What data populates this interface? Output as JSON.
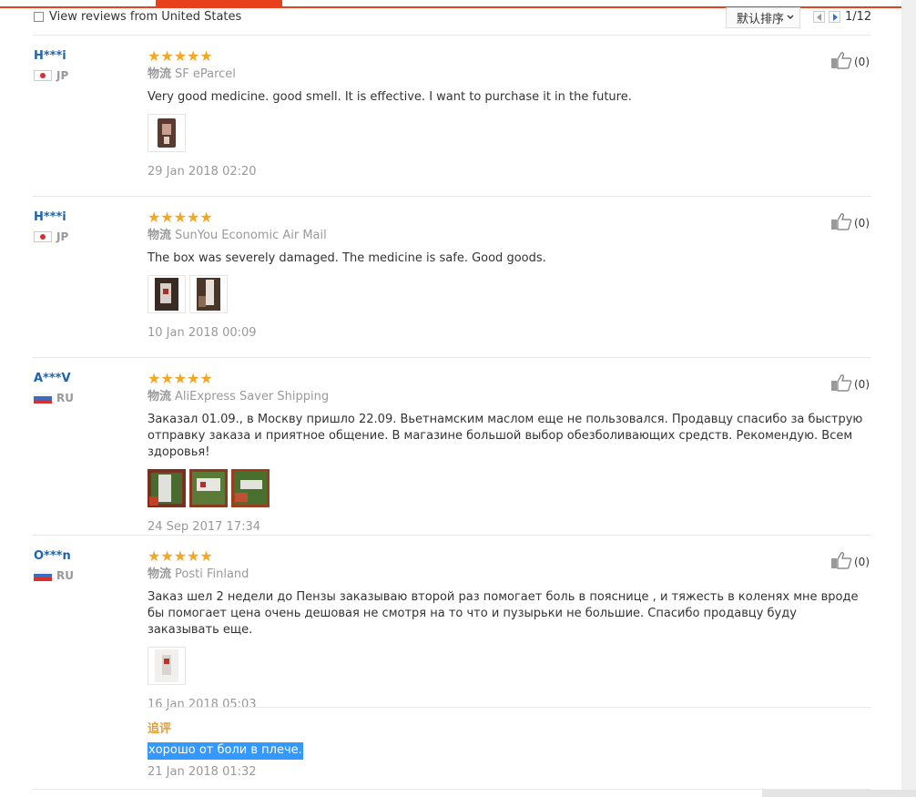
{
  "toolbar": {
    "filter_label": "View reviews from United States",
    "sort_label": "默认排序",
    "page_indicator": "1/12"
  },
  "reviews": [
    {
      "name": "H***i",
      "country": "JP",
      "stars": "★★★★★",
      "shipping_label": "物流",
      "shipping": "SF eParcel",
      "text": "Very good medicine. good smell. It is effective. I want to purchase it in the future.",
      "date": "29 Jan 2018 02:20",
      "helpful": "(0)"
    },
    {
      "name": "H***i",
      "country": "JP",
      "stars": "★★★★★",
      "shipping_label": "物流",
      "shipping": "SunYou Economic Air Mail",
      "text": "The box was severely damaged. The medicine is safe. Good goods.",
      "date": "10 Jan 2018 00:09",
      "helpful": "(0)"
    },
    {
      "name": "A***V",
      "country": "RU",
      "stars": "★★★★★",
      "shipping_label": "物流",
      "shipping": "AliExpress Saver Shipping",
      "text": "Заказал 01.09., в Москву пришло 22.09. Вьетнамским маслом еще не пользовался. Продавцу спасибо за быструю отправку заказа и приятное общение. В магазине большой выбор обезболивающих средств. Рекомендую. Всем здоровья!",
      "date": "24 Sep 2017 17:34",
      "helpful": "(0)"
    },
    {
      "name": "O***n",
      "country": "RU",
      "stars": "★★★★★",
      "shipping_label": "物流",
      "shipping": "Posti Finland",
      "text": "Заказ шел 2 недели до Пензы заказываю второй раз помогает боль в пояснице , и тяжесть в коленях мне вроде бы помогает цена очень дешовая не смотря на то что и пузырьки не большие. Спасибо продавцу буду заказывать еще.",
      "date": "16 Jan 2018 05:03",
      "helpful": "(0)",
      "followup": {
        "label": "追评",
        "text": "хорошо от боли в плече.",
        "date": "21 Jan 2018 01:32"
      }
    }
  ],
  "colors": {
    "accent": "#e8401a",
    "name_link": "#1e63b0",
    "stars": "#f5a623",
    "followup_label": "#e89d2f",
    "selection": "#3399ff"
  },
  "icons": [
    "thumbs-up-icon",
    "flag-jp-icon",
    "flag-ru-icon",
    "star-icon",
    "checkbox-icon",
    "chevron-down-icon",
    "prev-arrow-icon",
    "next-arrow-icon"
  ]
}
